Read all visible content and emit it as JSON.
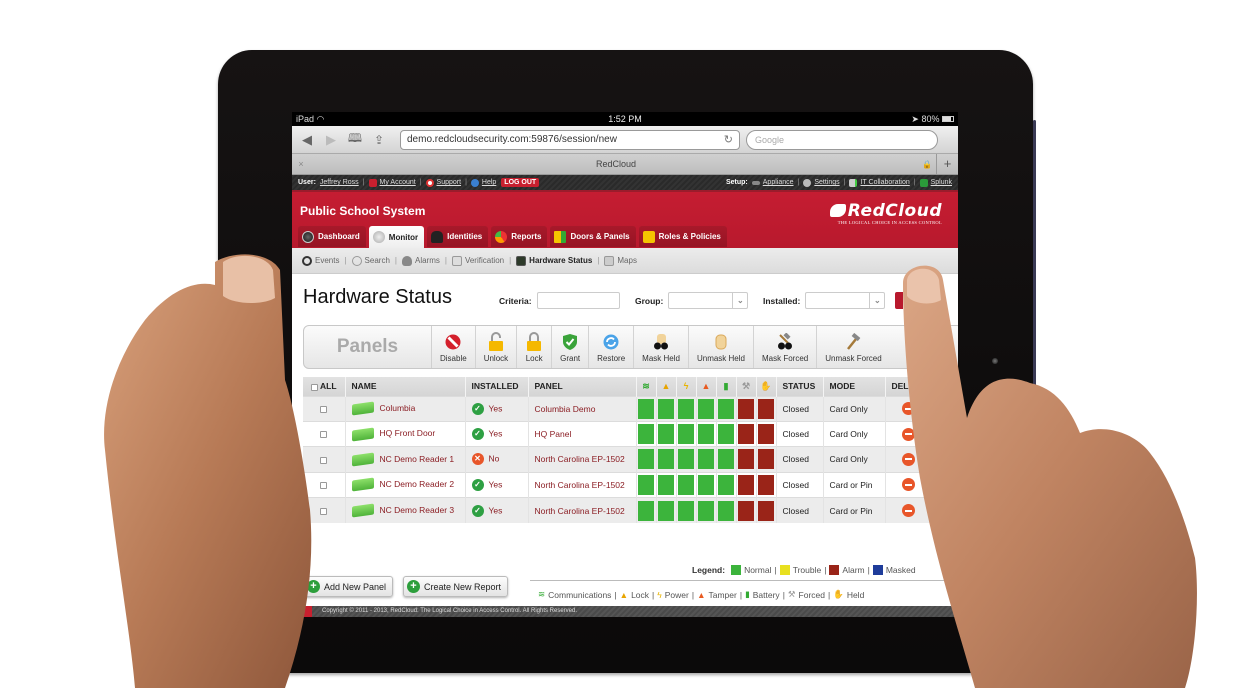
{
  "ios_status": {
    "device": "iPad",
    "time": "1:52 PM",
    "battery": "80%"
  },
  "browser": {
    "url": "demo.redcloudsecurity.com:59876/session/new",
    "search_placeholder": "Google",
    "tab_title": "RedCloud",
    "close_tab": "×",
    "new_tab": "+"
  },
  "topbar": {
    "user_label": "User:",
    "user_name": "Jeffrey Ross",
    "my_account": "My Account",
    "support": "Support",
    "help": "Help",
    "logout": "LOG OUT",
    "setup_label": "Setup:",
    "appliance": "Appliance",
    "settings": "Settings",
    "it_collaboration": "IT Collaboration",
    "splunk": "Splunk",
    "sep": "|"
  },
  "header": {
    "org_title": "Public School System",
    "logo_brand": "RedCloud",
    "logo_tagline": "THE LOGICAL CHOICE IN ACCESS CONTROL"
  },
  "main_tabs": [
    {
      "label": "Dashboard",
      "icon": "gauge-icon",
      "active": false
    },
    {
      "label": "Monitor",
      "icon": "camera-icon",
      "active": true
    },
    {
      "label": "Identities",
      "icon": "person-icon",
      "active": false
    },
    {
      "label": "Reports",
      "icon": "pie-chart-icon",
      "active": false
    },
    {
      "label": "Doors & Panels",
      "icon": "door-icon",
      "active": false
    },
    {
      "label": "Roles & Policies",
      "icon": "padlock-icon",
      "active": false
    }
  ],
  "subnav": [
    {
      "label": "Events",
      "icon": "clock-icon",
      "active": false
    },
    {
      "label": "Search",
      "icon": "magnifier-icon",
      "active": false
    },
    {
      "label": "Alarms",
      "icon": "bulb-icon",
      "active": false
    },
    {
      "label": "Verification",
      "icon": "id-card-icon",
      "active": false
    },
    {
      "label": "Hardware Status",
      "icon": "monitor-icon",
      "active": true
    },
    {
      "label": "Maps",
      "icon": "map-icon",
      "active": false
    }
  ],
  "page": {
    "title": "Hardware Status",
    "criteria_label": "Criteria:",
    "criteria_value": "",
    "group_label": "Group:",
    "group_value": "",
    "installed_label": "Installed:",
    "installed_value": ""
  },
  "toolbar": {
    "title": "Panels",
    "buttons": [
      {
        "label": "Disable",
        "icon": "no-entry-icon"
      },
      {
        "label": "Unlock",
        "icon": "unlocked-padlock-icon"
      },
      {
        "label": "Lock",
        "icon": "locked-padlock-icon"
      },
      {
        "label": "Grant",
        "icon": "shield-check-icon"
      },
      {
        "label": "Restore",
        "icon": "refresh-icon"
      },
      {
        "label": "Mask Held",
        "icon": "hand-mask-icon"
      },
      {
        "label": "Unmask Held",
        "icon": "hand-icon"
      },
      {
        "label": "Mask Forced",
        "icon": "hammer-mask-icon"
      },
      {
        "label": "Unmask Forced",
        "icon": "hammer-icon"
      }
    ]
  },
  "table": {
    "headers": {
      "all": "ALL",
      "name": "NAME",
      "installed": "INSTALLED",
      "panel": "PANEL",
      "status": "STATUS",
      "mode": "MODE",
      "delete": "DELETE"
    },
    "indicator_columns": [
      {
        "name": "communications-icon",
        "glyph": "📶"
      },
      {
        "name": "lock-icon",
        "glyph": "🔒"
      },
      {
        "name": "power-icon",
        "glyph": "⚡"
      },
      {
        "name": "tamper-icon",
        "glyph": "▲"
      },
      {
        "name": "battery-icon",
        "glyph": "▮"
      },
      {
        "name": "forced-icon",
        "glyph": "⚒"
      },
      {
        "name": "held-icon",
        "glyph": "✋"
      }
    ],
    "rows": [
      {
        "name": "Columbia",
        "installed": "Yes",
        "installed_ok": true,
        "panel": "Columbia Demo",
        "indicators": [
          "normal",
          "normal",
          "normal",
          "normal",
          "normal",
          "alarm",
          "alarm"
        ],
        "status": "Closed",
        "mode": "Card Only"
      },
      {
        "name": "HQ Front Door",
        "installed": "Yes",
        "installed_ok": true,
        "panel": "HQ Panel",
        "indicators": [
          "normal",
          "normal",
          "normal",
          "normal",
          "normal",
          "alarm",
          "alarm"
        ],
        "status": "Closed",
        "mode": "Card Only"
      },
      {
        "name": "NC Demo Reader 1",
        "installed": "No",
        "installed_ok": false,
        "panel": "North Carolina EP-1502",
        "indicators": [
          "normal",
          "normal",
          "normal",
          "normal",
          "normal",
          "alarm",
          "alarm"
        ],
        "status": "Closed",
        "mode": "Card Only"
      },
      {
        "name": "NC Demo Reader 2",
        "installed": "Yes",
        "installed_ok": true,
        "panel": "North Carolina EP-1502",
        "indicators": [
          "normal",
          "normal",
          "normal",
          "normal",
          "normal",
          "alarm",
          "alarm"
        ],
        "status": "Closed",
        "mode": "Card or Pin"
      },
      {
        "name": "NC Demo Reader 3",
        "installed": "Yes",
        "installed_ok": true,
        "panel": "North Carolina EP-1502",
        "indicators": [
          "normal",
          "normal",
          "normal",
          "normal",
          "normal",
          "alarm",
          "alarm"
        ],
        "status": "Closed",
        "mode": "Card or Pin"
      }
    ]
  },
  "legend": {
    "label": "Legend:",
    "items": [
      {
        "label": "Normal",
        "color": "#3cb43c"
      },
      {
        "label": "Trouble",
        "color": "#e8e020"
      },
      {
        "label": "Alarm",
        "color": "#9a2418"
      },
      {
        "label": "Masked",
        "color": "#1e3c9a"
      }
    ],
    "icon_key": [
      {
        "label": "Communications",
        "icon": "communications-icon"
      },
      {
        "label": "Lock",
        "icon": "lock-icon"
      },
      {
        "label": "Power",
        "icon": "power-icon"
      },
      {
        "label": "Tamper",
        "icon": "tamper-icon"
      },
      {
        "label": "Battery",
        "icon": "battery-icon"
      },
      {
        "label": "Forced",
        "icon": "forced-icon"
      },
      {
        "label": "Held",
        "icon": "held-icon"
      }
    ]
  },
  "actions": {
    "add_new_panel": "Add New Panel",
    "create_new_report": "Create New Report"
  },
  "footer": {
    "copyright": "Copyright © 2011 - 2013, RedCloud: The Logical Choice in Access Control. All Rights Reserved."
  },
  "colors": {
    "brand_red": "#c51d32",
    "normal": "#3cb43c",
    "alarm": "#9a2418",
    "link_dark_red": "#8b1e24"
  }
}
